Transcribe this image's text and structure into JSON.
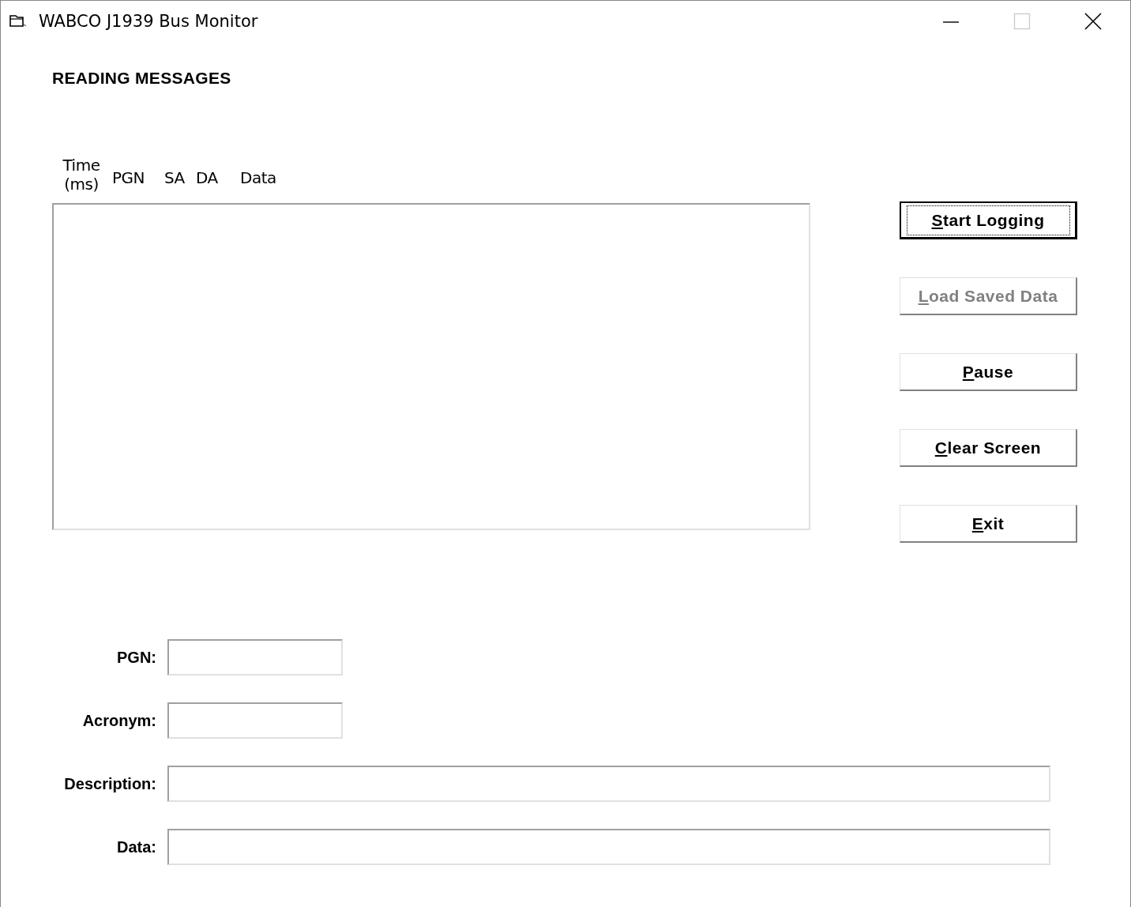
{
  "window": {
    "title": "WABCO J1939 Bus Monitor"
  },
  "heading": "READING MESSAGES",
  "columns": [
    "Time (ms)",
    "PGN",
    "SA",
    "DA",
    "Data"
  ],
  "buttons": [
    {
      "label": "Start Logging",
      "mnemonic_underlined": true,
      "default": true,
      "disabled": false
    },
    {
      "label": "Load Saved Data",
      "mnemonic_underlined": true,
      "default": false,
      "disabled": true
    },
    {
      "label": "Pause",
      "mnemonic_underlined": true,
      "default": false,
      "disabled": false
    },
    {
      "label": "Clear Screen",
      "mnemonic_underlined": true,
      "default": false,
      "disabled": false
    },
    {
      "label": "Exit",
      "mnemonic_underlined": true,
      "default": false,
      "disabled": false
    }
  ],
  "fields": [
    {
      "label": "PGN:",
      "kind": "short"
    },
    {
      "label": "Acronym:",
      "kind": "short"
    },
    {
      "label": "Description:",
      "kind": "long"
    },
    {
      "label": "Data:",
      "kind": "long"
    }
  ]
}
